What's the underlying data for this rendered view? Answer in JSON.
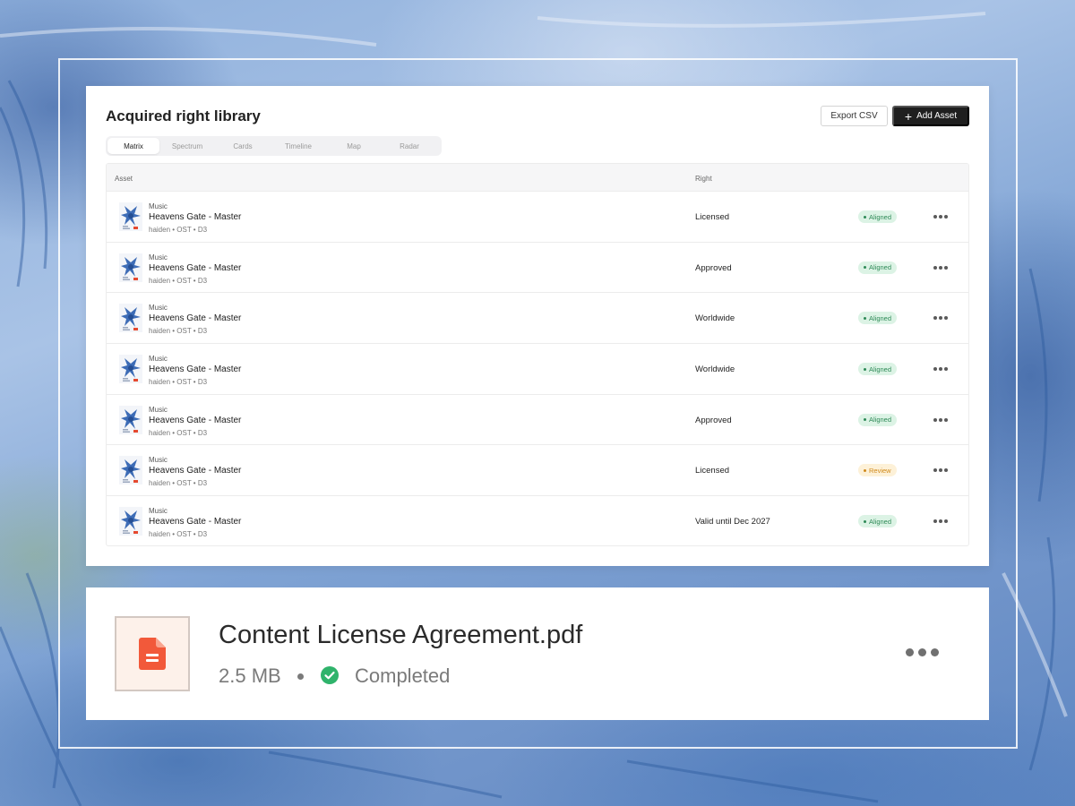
{
  "library": {
    "title": "Acquired right library",
    "export_label": "Export CSV",
    "add_label": "Add Asset",
    "tabs": [
      "Matrix",
      "Spectrum",
      "Cards",
      "Timeline",
      "Map",
      "Radar"
    ],
    "active_tab": "Matrix",
    "columns": {
      "asset": "Asset",
      "right": "Right"
    },
    "rows": [
      {
        "category": "Music",
        "name": "Heavens Gate - Master",
        "meta": "haiden • OST • D3",
        "right": "Licensed",
        "status": "Aligned",
        "status_type": "aligned"
      },
      {
        "category": "Music",
        "name": "Heavens Gate - Master",
        "meta": "haiden • OST • D3",
        "right": "Approved",
        "status": "Aligned",
        "status_type": "aligned"
      },
      {
        "category": "Music",
        "name": "Heavens Gate - Master",
        "meta": "haiden • OST • D3",
        "right": "Worldwide",
        "status": "Aligned",
        "status_type": "aligned"
      },
      {
        "category": "Music",
        "name": "Heavens Gate - Master",
        "meta": "haiden • OST • D3",
        "right": "Worldwide",
        "status": "Aligned",
        "status_type": "aligned"
      },
      {
        "category": "Music",
        "name": "Heavens Gate - Master",
        "meta": "haiden • OST • D3",
        "right": "Approved",
        "status": "Aligned",
        "status_type": "aligned"
      },
      {
        "category": "Music",
        "name": "Heavens Gate - Master",
        "meta": "haiden • OST • D3",
        "right": "Licensed",
        "status": "Review",
        "status_type": "review"
      },
      {
        "category": "Music",
        "name": "Heavens Gate - Master",
        "meta": "haiden • OST • D3",
        "right": "Valid until Dec 2027",
        "status": "Aligned",
        "status_type": "aligned"
      }
    ]
  },
  "file": {
    "name": "Content License Agreement.pdf",
    "size": "2.5 MB",
    "status": "Completed",
    "icon": "pdf-file-icon",
    "status_icon": "check-circle-icon"
  },
  "colors": {
    "aligned": "#2e8a57",
    "review": "#d08a1c",
    "file_icon": "#f2593a",
    "completed": "#2fb36b",
    "primary_button": "#1f1f1f"
  }
}
